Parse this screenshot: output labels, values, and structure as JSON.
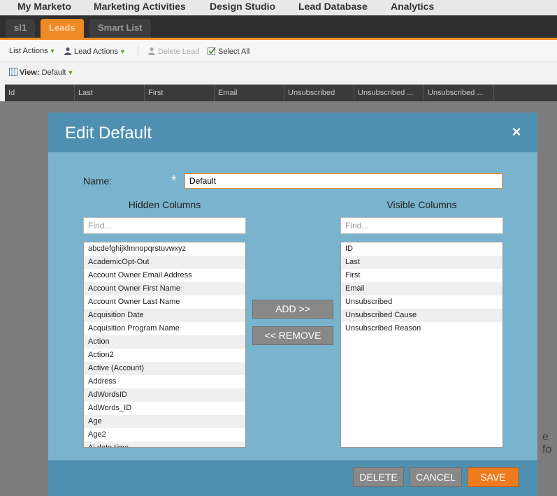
{
  "topnav": {
    "items": [
      "My Marketo",
      "Marketing Activities",
      "Design Studio",
      "Lead Database",
      "Analytics"
    ]
  },
  "tabs": [
    {
      "label": "sl1",
      "active": false
    },
    {
      "label": "Leads",
      "active": true
    },
    {
      "label": "Smart List",
      "active": false
    }
  ],
  "toolbar": {
    "list_actions": "List Actions",
    "lead_actions": "Lead Actions",
    "delete_lead": "Delete Lead",
    "select_all": "Select All"
  },
  "viewbar": {
    "label": "View:",
    "value": "Default"
  },
  "grid": {
    "columns": [
      "Id",
      "Last",
      "First",
      "Email",
      "Unsubscribed",
      "Unsubscribed ...",
      "Unsubscribed ..."
    ]
  },
  "background_text": "e fo",
  "modal": {
    "title": "Edit Default",
    "close": "×",
    "name_label": "Name:",
    "required_marker": "*",
    "name_value": "Default",
    "hidden_title": "Hidden Columns",
    "visible_title": "Visible Columns",
    "find_placeholder": "Find...",
    "hidden_columns": [
      "abcdefghijklmnopqrstuvwxyz",
      "AcademicOpt-Out",
      "Account Owner Email Address",
      "Account Owner First Name",
      "Account Owner Last Name",
      "Acquisition Date",
      "Acquisition Program Name",
      "Action",
      "Action2",
      "Active (Account)",
      "Address",
      "AdWordsID",
      "AdWords_ID",
      "Age",
      "Age2",
      "Ai date time"
    ],
    "visible_columns": [
      "ID",
      "Last",
      "First",
      "Email",
      "Unsubscribed",
      "Unsubscribed Cause",
      "Unsubscribed Reason"
    ],
    "add_button": "ADD >>",
    "remove_button": "<< REMOVE",
    "delete_button": "DELETE",
    "cancel_button": "CANCEL",
    "save_button": "SAVE"
  },
  "colors": {
    "accent": "#f08a24",
    "modal_body": "#7ab3cd",
    "modal_header": "#4f8fb0",
    "save": "#f07a1e"
  }
}
